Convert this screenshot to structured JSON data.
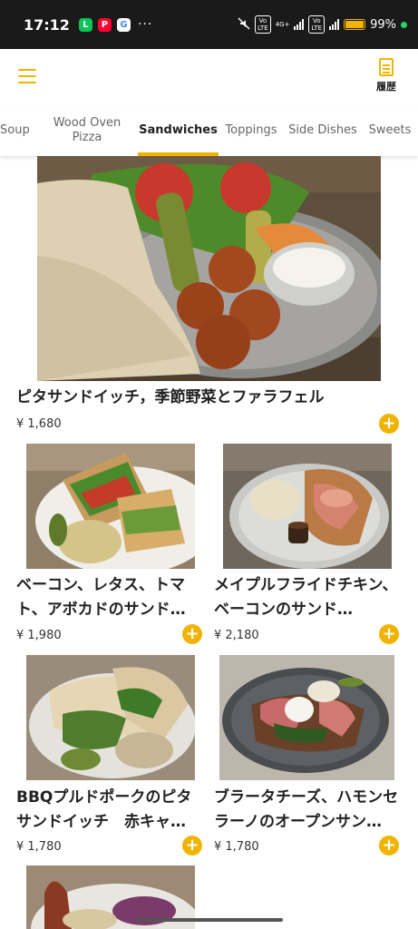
{
  "status_bar": {
    "time": "17:12",
    "app_icons": [
      "line-icon",
      "paypay-icon",
      "google-icon"
    ],
    "more": "···",
    "network": "4G+",
    "battery": "99%",
    "battery_level": 0.99
  },
  "header": {
    "menu_icon": "hamburger-icon",
    "history_icon": "document-icon",
    "history_label": "履歴"
  },
  "tabs": [
    {
      "label": "Soup"
    },
    {
      "label": "Wood Oven\nPizza"
    },
    {
      "label": "Sandwiches",
      "active": true
    },
    {
      "label": "Toppings"
    },
    {
      "label": "Side Dishes"
    },
    {
      "label": "Sweets"
    }
  ],
  "items": [
    {
      "name": "ピタサンドイッチ，季節野菜とファラフェル",
      "price": "¥ 1,680"
    },
    {
      "name": "ベーコン、レタス、トマト、アボカドのサンド…",
      "price": "¥ 1,980"
    },
    {
      "name": "メイプルフライドチキン、ベーコンのサンド…",
      "price": "¥ 2,180"
    },
    {
      "name": "BBQプルドポークのピタサンドイッチ　赤キャ…",
      "price": "¥ 1,780"
    },
    {
      "name": "ブラータチーズ、ハモンセラーノのオープンサン…",
      "price": "¥ 1,780"
    }
  ],
  "add_icon": "+",
  "colors": {
    "accent": "#f0b400",
    "status_bar": "#1a1a1a"
  }
}
